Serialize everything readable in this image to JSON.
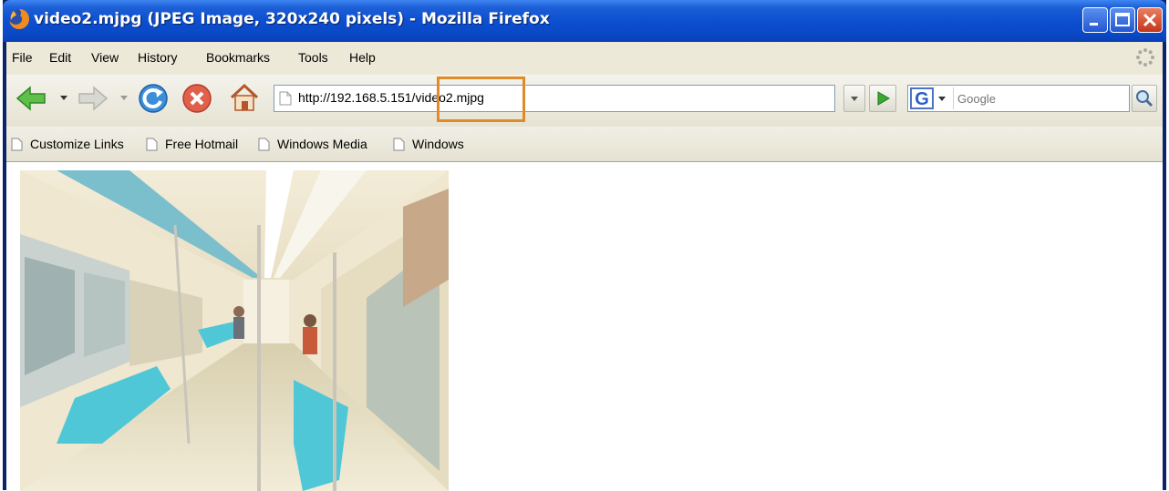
{
  "window": {
    "title": "video2.mjpg (JPEG Image, 320x240 pixels) - Mozilla Firefox",
    "controls": [
      "minimize",
      "maximize",
      "close"
    ]
  },
  "menu": {
    "items": [
      {
        "label": "File",
        "name": "file"
      },
      {
        "label": "Edit",
        "name": "edit"
      },
      {
        "label": "View",
        "name": "view"
      },
      {
        "label": "History",
        "name": "history"
      },
      {
        "label": "Bookmarks",
        "name": "bookmarks"
      },
      {
        "label": "Tools",
        "name": "tools"
      },
      {
        "label": "Help",
        "name": "help"
      }
    ]
  },
  "navigation": {
    "url": "http://192.168.5.151/video2.mjpg",
    "highlighted_segment": "video2.mjpg",
    "search_placeholder": "Google",
    "buttons": [
      "back-icon",
      "forward-icon",
      "reload-icon",
      "stop-icon",
      "home-icon",
      "go-icon",
      "search-icon"
    ]
  },
  "bookmarks": {
    "items": [
      {
        "label": "Customize Links"
      },
      {
        "label": "Free Hotmail"
      },
      {
        "label": "Windows Media"
      },
      {
        "label": "Windows"
      }
    ]
  },
  "content": {
    "image": "subway-train-interior"
  },
  "colors": {
    "titlebar": "#0c4fd1",
    "chrome": "#ece9d8",
    "highlight_box": "#e08a2a"
  }
}
